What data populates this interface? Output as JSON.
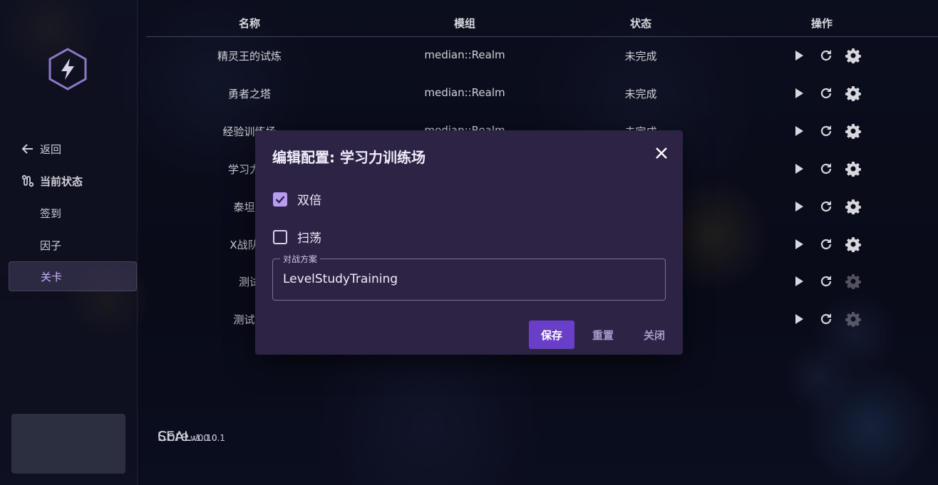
{
  "sidebar": {
    "logo_icon": "lightning-hexagon-icon",
    "nav": [
      {
        "label": "返回",
        "icon": "arrow-left-icon"
      },
      {
        "label": "当前状态",
        "icon": "route-icon"
      },
      {
        "label": "签到"
      },
      {
        "label": "因子"
      },
      {
        "label": "关卡",
        "active": true
      }
    ],
    "version": {
      "app_name": "SEAL",
      "app_version": "v0.10.1",
      "core_name": "Core",
      "core_version": "v1.0.0"
    }
  },
  "table": {
    "headers": {
      "name": "名称",
      "module": "模组",
      "status": "状态",
      "actions": "操作"
    },
    "rows": [
      {
        "name": "精灵王的试炼",
        "module": "median::Realm",
        "status": "未完成"
      },
      {
        "name": "勇者之塔",
        "module": "median::Realm",
        "status": "未完成"
      },
      {
        "name": "经验训练场",
        "module": "median::Realm",
        "status": "未完成"
      },
      {
        "name": "学习力训",
        "module": "",
        "status": ""
      },
      {
        "name": "泰坦矿",
        "module": "",
        "status": ""
      },
      {
        "name": "X战队密",
        "module": "",
        "status": ""
      },
      {
        "name": "测试",
        "module": "",
        "status": ""
      },
      {
        "name": "测试錾",
        "module": "",
        "status": ""
      }
    ],
    "action_icons": [
      "play-icon",
      "refresh-icon",
      "gear-icon"
    ]
  },
  "dialog": {
    "title": "编辑配置: 学习力训练场",
    "options": [
      {
        "label": "双倍",
        "checked": true
      },
      {
        "label": "扫荡",
        "checked": false
      }
    ],
    "field": {
      "label": "对战方案",
      "value": "LevelStudyTraining"
    },
    "buttons": {
      "save": "保存",
      "reset": "重置",
      "close": "关闭"
    }
  },
  "colors": {
    "accent": "#6a3fc8",
    "dialog_bg": "#2d2345",
    "checkbox_on": "#b79cf0"
  }
}
